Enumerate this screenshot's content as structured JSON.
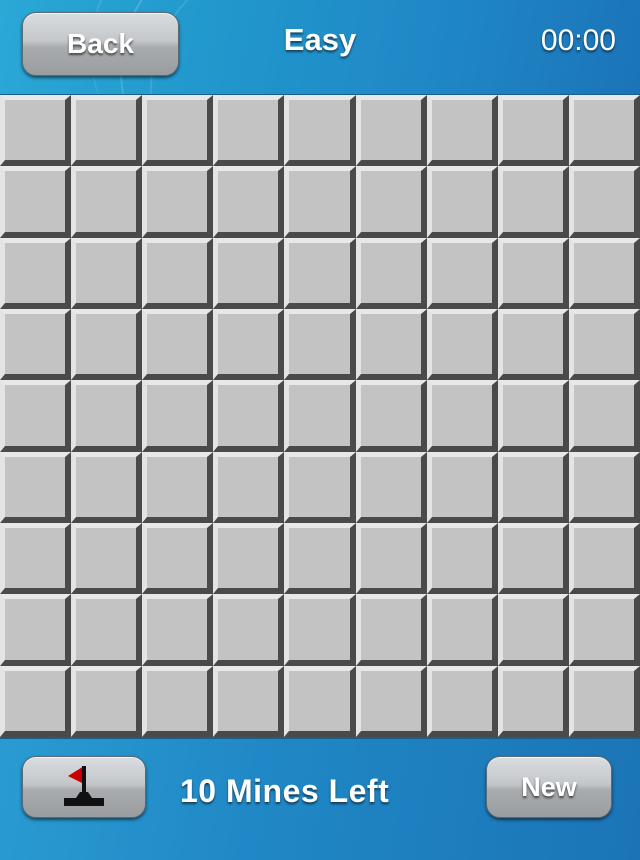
{
  "header": {
    "back_label": "Back",
    "title": "Easy",
    "timer": "00:00"
  },
  "board": {
    "rows": 9,
    "cols": 9,
    "cell_state": "unrevealed",
    "colors": {
      "cell_face": "#c3c3c3",
      "cell_highlight": "#e8e8e8",
      "cell_shadow": "#4a4a4a"
    }
  },
  "footer": {
    "flag_button_icon": "flag-icon",
    "mines_left_text": "10 Mines Left",
    "mines_left_count": 10,
    "new_label": "New"
  },
  "theme": {
    "bar_blue": "#2197cc",
    "flag_red": "#cc0000"
  }
}
